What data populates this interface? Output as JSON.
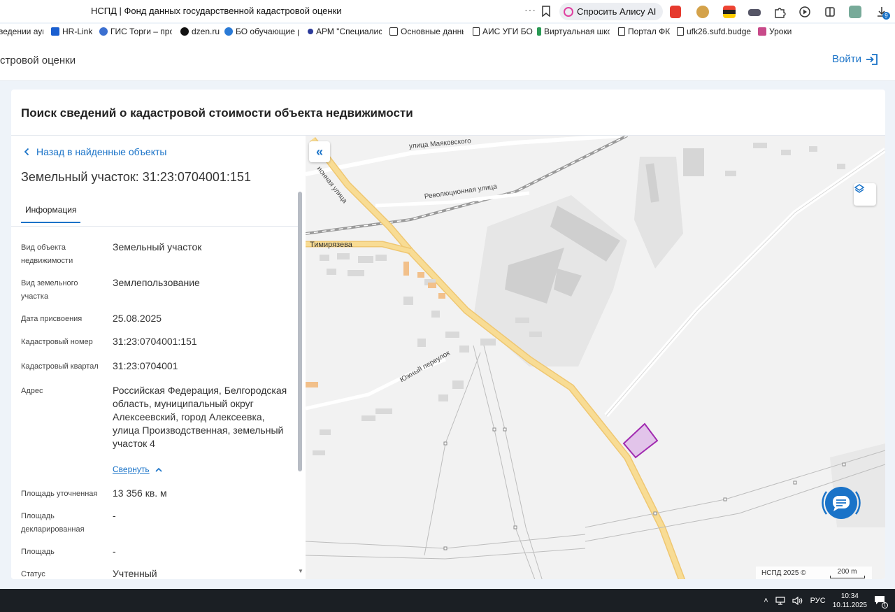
{
  "browser": {
    "tab_title": "НСПД | Фонд данных государственной кадастровой оценки",
    "more": "···",
    "alice_label": "Спросить Алису AI",
    "download_badge": "9"
  },
  "bookmarks": [
    {
      "label": "ведении аукц"
    },
    {
      "label": "HR-Link"
    },
    {
      "label": "ГИС Торги – прод"
    },
    {
      "label": "dzen.ru"
    },
    {
      "label": "БО обучающие рс"
    },
    {
      "label": "АРМ \"Специалис"
    },
    {
      "label": "Основные данны"
    },
    {
      "label": "АИС УГИ БО"
    },
    {
      "label": "Виртуальная шко"
    },
    {
      "label": "Портал ФК"
    },
    {
      "label": "ufk26.sufd.budget"
    },
    {
      "label": "Уроки"
    }
  ],
  "header": {
    "site_name": "стровой оценки",
    "login_label": "Войти"
  },
  "panel": {
    "title": "Поиск сведений о кадастровой стоимости объекта недвижимости",
    "back_label": "Назад в найденные объекты",
    "object_title": "Земельный участок: 31:23:0704001:151",
    "tab_label": "Информация",
    "collapse_label": "Свернуть"
  },
  "info": {
    "type_label": "Вид объекта недвижимости",
    "type_value": "Земельный участок",
    "land_type_label": "Вид земельного участка",
    "land_type_value": "Землепользование",
    "date_label": "Дата присвоения",
    "date_value": "25.08.2025",
    "cad_num_label": "Кадастровый номер",
    "cad_num_value": "31:23:0704001:151",
    "quarter_label": "Кадастровый квартал",
    "quarter_value": "31:23:0704001",
    "address_label": "Адрес",
    "address_value": "Российская Федерация, Белгородская область, муниципальный округ Алексеевский, город Алексеевка, улица Производственная, земельный участок 4",
    "area_refined_label": "Площадь уточненная",
    "area_refined_value": "13 356 кв. м",
    "area_declared_label": "Площадь декларированная",
    "area_declared_value": "-",
    "area_label": "Площадь",
    "area_value": "-",
    "status_label": "Статус",
    "status_value": "Учтенный"
  },
  "map": {
    "streets": {
      "mayakovskogo": "улица Маяковского",
      "revolutsionnaya": "Революционная улица",
      "ionnaya": "ионная улица",
      "timiryazeva": "Тимирязева",
      "yuzhny": "Южный переулок"
    },
    "attribution": "НСПД 2025 ©",
    "scale": "200 m",
    "colors": {
      "road_main": "#f7d98a",
      "parcel_fill": "#e2c4ea",
      "parcel_stroke": "#a12bb0",
      "building": "#d8d8d8"
    }
  },
  "taskbar": {
    "lang": "РУС",
    "time": "10:34",
    "date": "10.11.2025",
    "notif_count": "1"
  }
}
